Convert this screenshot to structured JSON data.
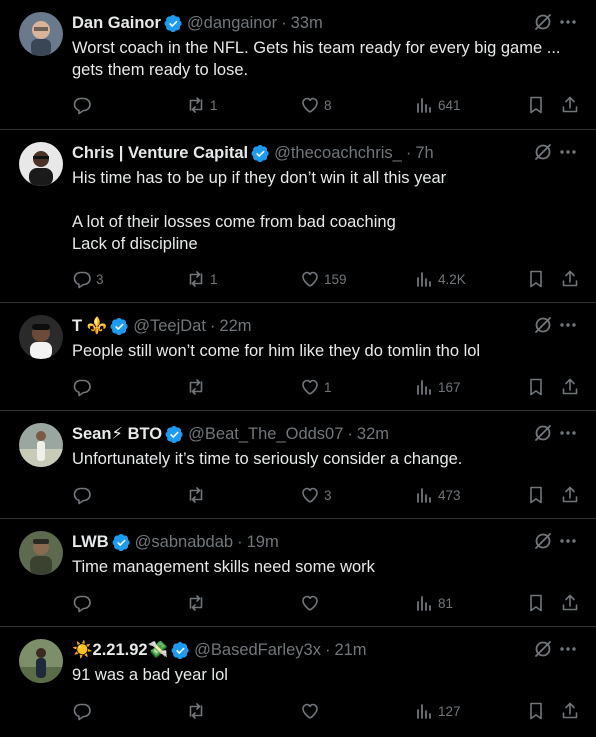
{
  "tweets": [
    {
      "name": "Dan Gainor",
      "handle": "@dangainor",
      "time": "33m",
      "text": "Worst coach in the NFL. Gets his team ready for every big game ...\ngets them ready to lose.",
      "replies": "",
      "reposts": "1",
      "likes": "8",
      "views": "641"
    },
    {
      "name": "Chris | Venture Capital",
      "handle": "@thecoachchris_",
      "time": "7h",
      "text": "His time has to be up if they don’t win it all this year\n\nA lot of their losses come from bad coaching\nLack of discipline",
      "replies": "3",
      "reposts": "1",
      "likes": "159",
      "views": "4.2K"
    },
    {
      "name": "T ⚜️",
      "handle": "@TeejDat",
      "time": "22m",
      "text": "People still won’t come for him like they do tomlin tho lol",
      "replies": "",
      "reposts": "",
      "likes": "1",
      "views": "167"
    },
    {
      "name": "Sean⚡ BTO",
      "handle": "@Beat_The_Odds07",
      "time": "32m",
      "text": "Unfortunately it’s time to seriously consider a change.",
      "replies": "",
      "reposts": "",
      "likes": "3",
      "views": "473"
    },
    {
      "name": "LWB",
      "handle": "@sabnabdab",
      "time": "19m",
      "text": "Time management skills need some work",
      "replies": "",
      "reposts": "",
      "likes": "",
      "views": "81"
    },
    {
      "name": "☀️2.21.92💸",
      "handle": "@BasedFarley3x",
      "time": "21m",
      "text": "91 was a bad year lol",
      "replies": "",
      "reposts": "",
      "likes": "",
      "views": "127"
    }
  ],
  "icons": {
    "verified": "verified-badge-icon",
    "grok": "grok-icon",
    "more": "more-icon",
    "reply": "reply-icon",
    "repost": "repost-icon",
    "like": "like-icon",
    "views": "views-icon",
    "bookmark": "bookmark-icon",
    "share": "share-icon"
  },
  "colors": {
    "background": "#000000",
    "text": "#e7e9ea",
    "muted": "#71767b",
    "verified": "#1d9bf0",
    "border": "#2f3336"
  }
}
